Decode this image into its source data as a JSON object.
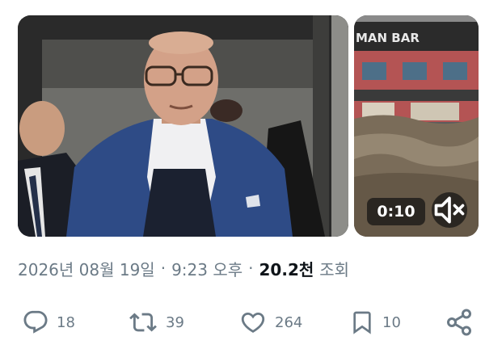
{
  "media": {
    "video": {
      "duration": "0:10"
    }
  },
  "meta": {
    "date": "2026년 08월 19일",
    "separator1": "·",
    "time": "9:23 오후",
    "separator2": "·",
    "views_count": "20.2천",
    "views_label": "조회"
  },
  "actions": {
    "reply_count": "18",
    "retweet_count": "39",
    "like_count": "264",
    "bookmark_count": "10"
  },
  "colors": {
    "text_secondary": "#6b7a86",
    "text_primary": "#0f1419"
  }
}
